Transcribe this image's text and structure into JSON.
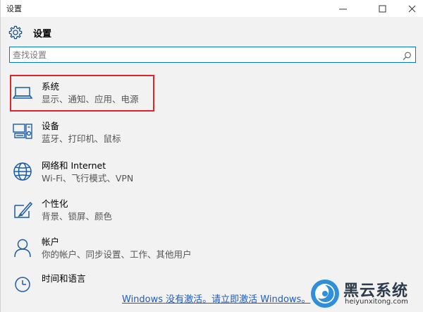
{
  "window": {
    "title": "设置",
    "controls": [
      "minimize",
      "maximize",
      "close"
    ]
  },
  "header": {
    "title": "设置",
    "icon": "gear-icon"
  },
  "search": {
    "placeholder": "查找设置",
    "value": "",
    "icon": "search-icon"
  },
  "items": [
    {
      "label": "系统",
      "desc": "显示、通知、应用、电源",
      "icon": "laptop-icon",
      "selected": true
    },
    {
      "label": "设备",
      "desc": "蓝牙、打印机、鼠标",
      "icon": "devices-icon",
      "selected": false
    },
    {
      "label": "网络和 Internet",
      "desc": "Wi-Fi、飞行模式、VPN",
      "icon": "globe-icon",
      "selected": false
    },
    {
      "label": "个性化",
      "desc": "背景、锁屏、颜色",
      "icon": "paint-icon",
      "selected": false
    },
    {
      "label": "帐户",
      "desc": "你的帐户、同步设置、工作、其他用户",
      "icon": "person-icon",
      "selected": false
    },
    {
      "label": "时间和语言",
      "desc": "",
      "icon": "clock-language-icon",
      "selected": false
    }
  ],
  "activation": {
    "text": "Windows 没有激活。请立即激活 Windows。"
  },
  "watermark": {
    "title": "黑云系统",
    "url": "heiyunxitong.com"
  },
  "colors": {
    "accent": "#0078d7",
    "selection_outline": "#e0262a",
    "link": "#1c5bc7",
    "background": "#f2f2f2"
  }
}
